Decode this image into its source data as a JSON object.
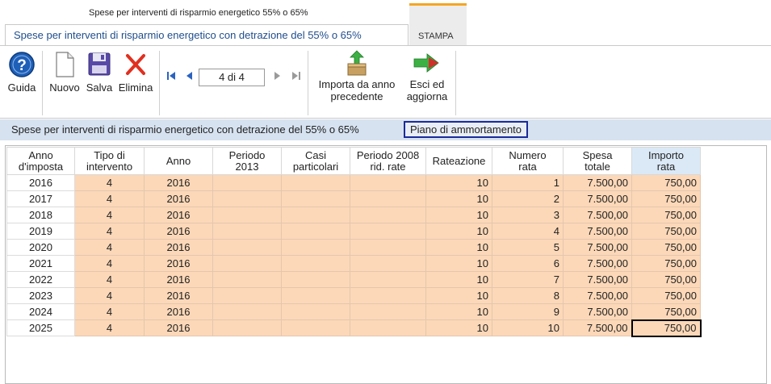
{
  "window": {
    "title": "Spese per interventi di risparmio energetico 55% o 65%"
  },
  "tabs": [
    {
      "label": "Spese per interventi di risparmio energetico con detrazione del 55% o 65%"
    },
    {
      "label": "STAMPA"
    }
  ],
  "toolbar": {
    "guida": "Guida",
    "nuovo": "Nuovo",
    "salva": "Salva",
    "elimina": "Elimina",
    "record": "4 di 4",
    "importa_1": "Importa da anno",
    "importa_2": "precedente",
    "esci_1": "Esci ed",
    "esci_2": "aggiorna"
  },
  "section": {
    "label": "Spese per interventi di risparmio energetico con detrazione del 55% o 65%",
    "subtab": "Piano di ammortamento"
  },
  "table": {
    "headers": [
      [
        "Anno",
        "d'imposta"
      ],
      [
        "Tipo di",
        "intervento"
      ],
      [
        "Anno",
        ""
      ],
      [
        "Periodo",
        "2013"
      ],
      [
        "Casi",
        "particolari"
      ],
      [
        "Periodo 2008",
        "rid. rate"
      ],
      [
        "Rateazione",
        ""
      ],
      [
        "Numero",
        "rata"
      ],
      [
        "Spesa",
        "totale"
      ],
      [
        "Importo",
        "rata"
      ]
    ],
    "rows": [
      [
        "2016",
        "4",
        "2016",
        "",
        "",
        "",
        "10",
        "1",
        "7.500,00",
        "750,00"
      ],
      [
        "2017",
        "4",
        "2016",
        "",
        "",
        "",
        "10",
        "2",
        "7.500,00",
        "750,00"
      ],
      [
        "2018",
        "4",
        "2016",
        "",
        "",
        "",
        "10",
        "3",
        "7.500,00",
        "750,00"
      ],
      [
        "2019",
        "4",
        "2016",
        "",
        "",
        "",
        "10",
        "4",
        "7.500,00",
        "750,00"
      ],
      [
        "2020",
        "4",
        "2016",
        "",
        "",
        "",
        "10",
        "5",
        "7.500,00",
        "750,00"
      ],
      [
        "2021",
        "4",
        "2016",
        "",
        "",
        "",
        "10",
        "6",
        "7.500,00",
        "750,00"
      ],
      [
        "2022",
        "4",
        "2016",
        "",
        "",
        "",
        "10",
        "7",
        "7.500,00",
        "750,00"
      ],
      [
        "2023",
        "4",
        "2016",
        "",
        "",
        "",
        "10",
        "8",
        "7.500,00",
        "750,00"
      ],
      [
        "2024",
        "4",
        "2016",
        "",
        "",
        "",
        "10",
        "9",
        "7.500,00",
        "750,00"
      ],
      [
        "2025",
        "4",
        "2016",
        "",
        "",
        "",
        "10",
        "10",
        "7.500,00",
        "750,00"
      ]
    ]
  },
  "colors": {
    "accent": "#1f4e8c",
    "cell_fill": "#fcd8b8",
    "section_bar": "#d6e2f0",
    "active_header": "#dbe9f7",
    "stampa_top": "#f5a623"
  },
  "icons": [
    "help-icon",
    "new-document-icon",
    "save-disk-icon",
    "delete-x-icon",
    "first-record-icon",
    "previous-record-icon",
    "next-record-icon",
    "last-record-icon",
    "import-box-icon",
    "exit-arrow-icon"
  ]
}
